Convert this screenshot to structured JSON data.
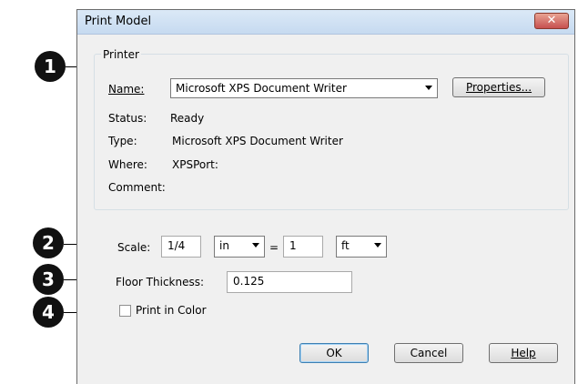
{
  "dialog": {
    "title": "Print Model",
    "close_glyph": "✕"
  },
  "printer": {
    "group_label": "Printer",
    "name_label": "Name:",
    "name_value": "Microsoft XPS Document Writer",
    "properties_button": "Properties...",
    "status_label": "Status:",
    "status_value": "Ready",
    "type_label": "Type:",
    "type_value": "Microsoft XPS Document Writer",
    "where_label": "Where:",
    "where_value": "XPSPort:",
    "comment_label": "Comment:"
  },
  "scale": {
    "label": "Scale:",
    "left_value": "1/4",
    "left_unit": "in",
    "equals": "=",
    "right_value": "1",
    "right_unit": "ft"
  },
  "floor": {
    "label": "Floor Thickness:",
    "value": "0.125"
  },
  "color": {
    "label": "Print in Color",
    "checked": false
  },
  "buttons": {
    "ok": "OK",
    "cancel": "Cancel",
    "help": "Help"
  },
  "callouts": [
    "1",
    "2",
    "3",
    "4"
  ]
}
